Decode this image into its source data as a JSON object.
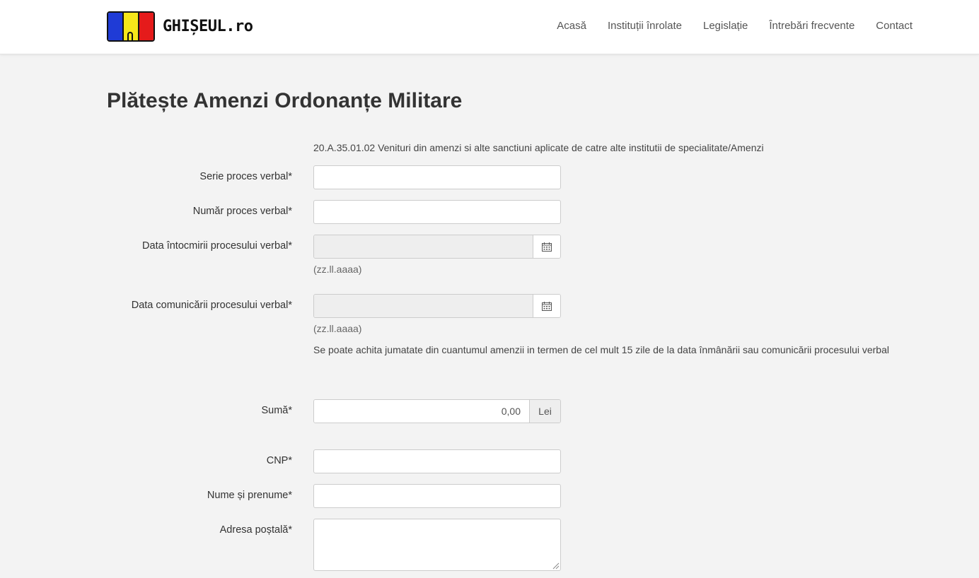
{
  "header": {
    "logo_text": "GHIȘEUL.ro",
    "nav": [
      "Acasă",
      "Instituții înrolate",
      "Legislație",
      "Întrebări frecvente",
      "Contact"
    ]
  },
  "page": {
    "title": "Plătește Amenzi Ordonanțe Militare",
    "info": "20.A.35.01.02 Venituri din amenzi si alte sanctiuni aplicate de catre alte institutii de specialitate/Amenzi"
  },
  "form": {
    "serie_label": "Serie proces verbal*",
    "numar_label": "Număr proces verbal*",
    "data_intocmirii_label": "Data întocmirii procesului verbal*",
    "data_comunicarii_label": "Data comunicării procesului verbal*",
    "date_hint": "(zz.ll.aaaa)",
    "half_note": "Se poate achita jumatate din cuantumul amenzii in termen de cel mult 15 zile de la data înmânării sau comunicării procesului verbal",
    "suma_label": "Sumă*",
    "suma_value": "0,00",
    "suma_currency": "Lei",
    "cnp_label": "CNP*",
    "nume_label": "Nume și prenume*",
    "adresa_label": "Adresa poștală*"
  },
  "icons": {
    "calendar": "calendar-icon",
    "resize": "resize-grip-icon"
  }
}
